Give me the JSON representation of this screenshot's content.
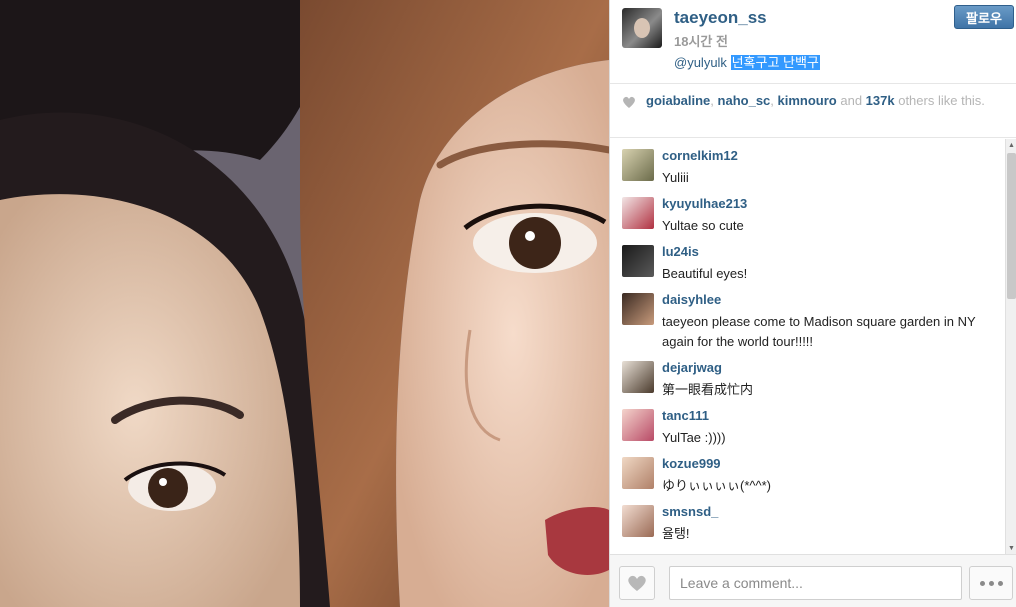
{
  "post": {
    "username": "taeyeon_ss",
    "time": "18시간 전",
    "follow_label": "팔로우",
    "caption_mention": "@yulyulk",
    "caption_text": "넌혹구고 난백구"
  },
  "likes": {
    "users": [
      "goiabaline",
      "naho_sc",
      "kimnouro"
    ],
    "count": "137k",
    "suffix": "others like this."
  },
  "comments": [
    {
      "user": "cornelkim12",
      "text": "Yuliii"
    },
    {
      "user": "kyuyulhae213",
      "text": "Yultae so cute"
    },
    {
      "user": "lu24is",
      "text": "Beautiful eyes!"
    },
    {
      "user": "daisyhlee",
      "text": "taeyeon please come to Madison square garden in NY again for the world tour!!!!!"
    },
    {
      "user": "dejarjwag",
      "text": "第一眼看成忙内"
    },
    {
      "user": "tanc111",
      "text": "YulTae :))))"
    },
    {
      "user": "kozue999",
      "text": "ゆりぃぃぃぃ(*^^*)"
    },
    {
      "user": "smsnsd_",
      "text": "율탱!"
    }
  ],
  "footer": {
    "comment_placeholder": "Leave a comment...",
    "like_icon": "heart-icon",
    "more_icon": "ellipsis-icon"
  },
  "colors": {
    "link": "#2f5f85",
    "muted": "#9a9a9a",
    "selection": "#3399ff",
    "button": "#3f74a7"
  }
}
